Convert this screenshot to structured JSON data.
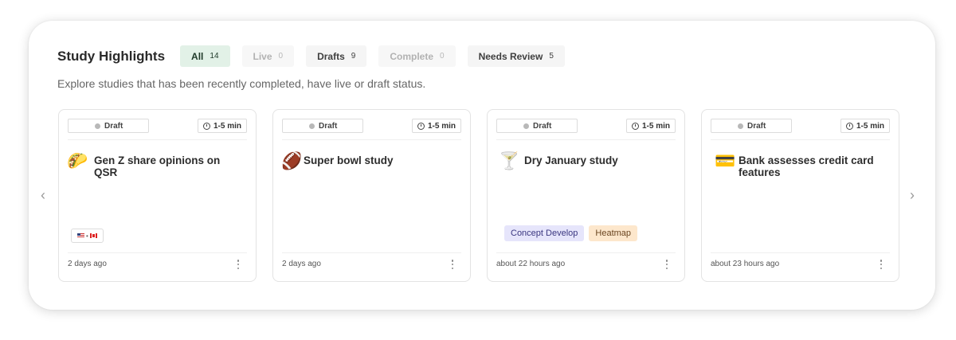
{
  "header": {
    "title": "Study Highlights",
    "subtitle": "Explore studies that has been recently completed, have live or draft status."
  },
  "tabs": [
    {
      "label": "All",
      "count": "14",
      "state": "active"
    },
    {
      "label": "Live",
      "count": "0",
      "state": "muted"
    },
    {
      "label": "Drafts",
      "count": "9",
      "state": "normal"
    },
    {
      "label": "Complete",
      "count": "0",
      "state": "muted"
    },
    {
      "label": "Needs Review",
      "count": "5",
      "state": "normal"
    }
  ],
  "nav": {
    "prev_icon": "chevron-left-icon",
    "next_icon": "chevron-right-icon"
  },
  "cards": [
    {
      "status": "Draft",
      "duration": "1-5 min",
      "emoji": "🌮",
      "emoji_icon": "taco-icon",
      "title": "Gen Z share opinions on QSR",
      "flags_sep": "•",
      "time": "2 days ago"
    },
    {
      "status": "Draft",
      "duration": "1-5 min",
      "emoji": "🏈",
      "emoji_icon": "football-icon",
      "title": "Super bowl study",
      "time": "2 days ago"
    },
    {
      "status": "Draft",
      "duration": "1-5 min",
      "emoji": "🍸",
      "emoji_icon": "cocktail-icon",
      "title": "Dry January study",
      "tags": [
        "Concept Develop",
        "Heatmap"
      ],
      "time": "about 22 hours ago"
    },
    {
      "status": "Draft",
      "duration": "1-5 min",
      "emoji": "💳",
      "emoji_icon": "credit-card-icon",
      "title": "Bank assesses credit card features",
      "time": "about 23 hours ago"
    }
  ],
  "colors": {
    "active_tab_bg": "#e2f1e7",
    "tag_purple_bg": "#e6e5fb",
    "tag_orange_bg": "#fde7cc",
    "status_dot": "#b8b8b8"
  }
}
